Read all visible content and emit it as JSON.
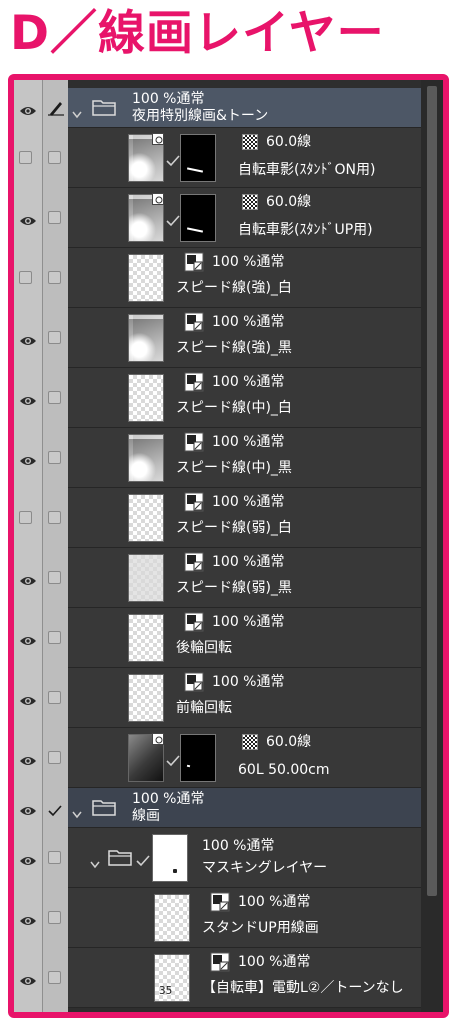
{
  "title": "D／線画レイヤー",
  "colors": {
    "accent": "#e8146a",
    "panel": "#383838",
    "selected_folder": "#4d5766"
  },
  "layers": [
    {
      "id": "folder1",
      "blend": "100 %通常",
      "name": "夜用特別線画&トーン"
    },
    {
      "id": "l1",
      "blend": "60.0線",
      "name": "自転車影(ｽﾀﾝﾄﾞON用)"
    },
    {
      "id": "l2",
      "blend": "60.0線",
      "name": "自転車影(ｽﾀﾝﾄﾞUP用)"
    },
    {
      "id": "l3",
      "blend": "100 %通常",
      "name": "スピード線(強)_白"
    },
    {
      "id": "l4",
      "blend": "100 %通常",
      "name": "スピード線(強)_黒"
    },
    {
      "id": "l5",
      "blend": "100 %通常",
      "name": "スピード線(中)_白"
    },
    {
      "id": "l6",
      "blend": "100 %通常",
      "name": "スピード線(中)_黒"
    },
    {
      "id": "l7",
      "blend": "100 %通常",
      "name": "スピード線(弱)_白"
    },
    {
      "id": "l8",
      "blend": "100 %通常",
      "name": "スピード線(弱)_黒"
    },
    {
      "id": "l9",
      "blend": "100 %通常",
      "name": "後輪回転"
    },
    {
      "id": "l10",
      "blend": "100 %通常",
      "name": "前輪回転"
    },
    {
      "id": "l11",
      "blend": "60.0線",
      "name": "60L 50.00cm"
    },
    {
      "id": "folder2",
      "blend": "100 %通常",
      "name": "線画"
    },
    {
      "id": "folder3",
      "blend": "100 %通常",
      "name": "マスキングレイヤー"
    },
    {
      "id": "l12",
      "blend": "100 %通常",
      "name": "スタンドUP用線画"
    },
    {
      "id": "l13",
      "blend": "100 %通常",
      "name": "【自転車】電動L②／トーンなし",
      "thumb_text": "35"
    }
  ]
}
